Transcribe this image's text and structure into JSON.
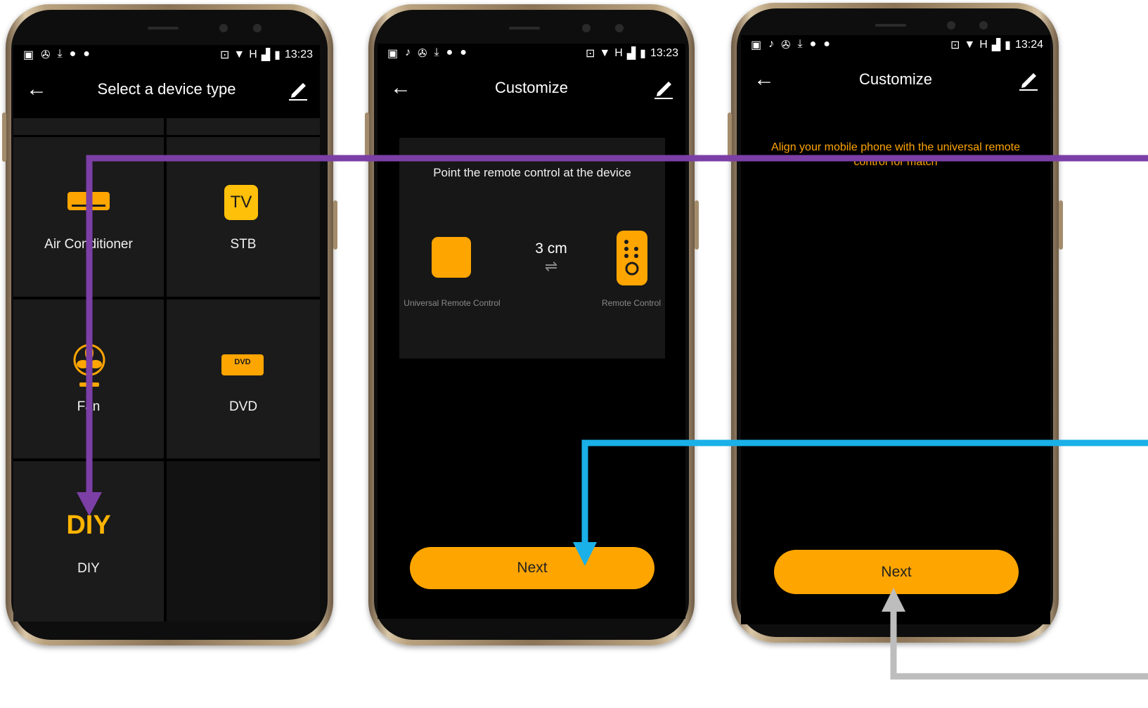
{
  "colors": {
    "accent": "#ffa500",
    "purple_arrow": "#7b3fa6",
    "blue_arrow": "#1ab0e8",
    "gray_arrow": "#bdbdbd"
  },
  "screen1": {
    "status": {
      "time": "13:23",
      "network": "H"
    },
    "nav": {
      "title": "Select a device type",
      "back_icon": "arrow-left-icon",
      "edit_icon": "pencil-icon"
    },
    "devices": [
      {
        "label": "Air Conditioner",
        "icon": "air-conditioner-icon"
      },
      {
        "label": "STB",
        "icon": "tv-icon",
        "icon_text": "TV"
      },
      {
        "label": "Fan",
        "icon": "fan-icon"
      },
      {
        "label": "DVD",
        "icon": "dvd-icon",
        "icon_text": "DVD"
      },
      {
        "label": "DIY",
        "icon": "diy-icon",
        "icon_text": "DIY"
      }
    ]
  },
  "screen2": {
    "status": {
      "time": "13:23",
      "network": "H"
    },
    "nav": {
      "title": "Customize"
    },
    "instruction": "Point the remote control at the device",
    "distance": "3 cm",
    "left_label": "Universal Remote Control",
    "right_label": "Remote Control",
    "next_label": "Next"
  },
  "screen3": {
    "status": {
      "time": "13:24",
      "network": "H"
    },
    "nav": {
      "title": "Customize"
    },
    "instruction": "Align your mobile phone with the universal remote control for match",
    "next_label": "Next"
  }
}
